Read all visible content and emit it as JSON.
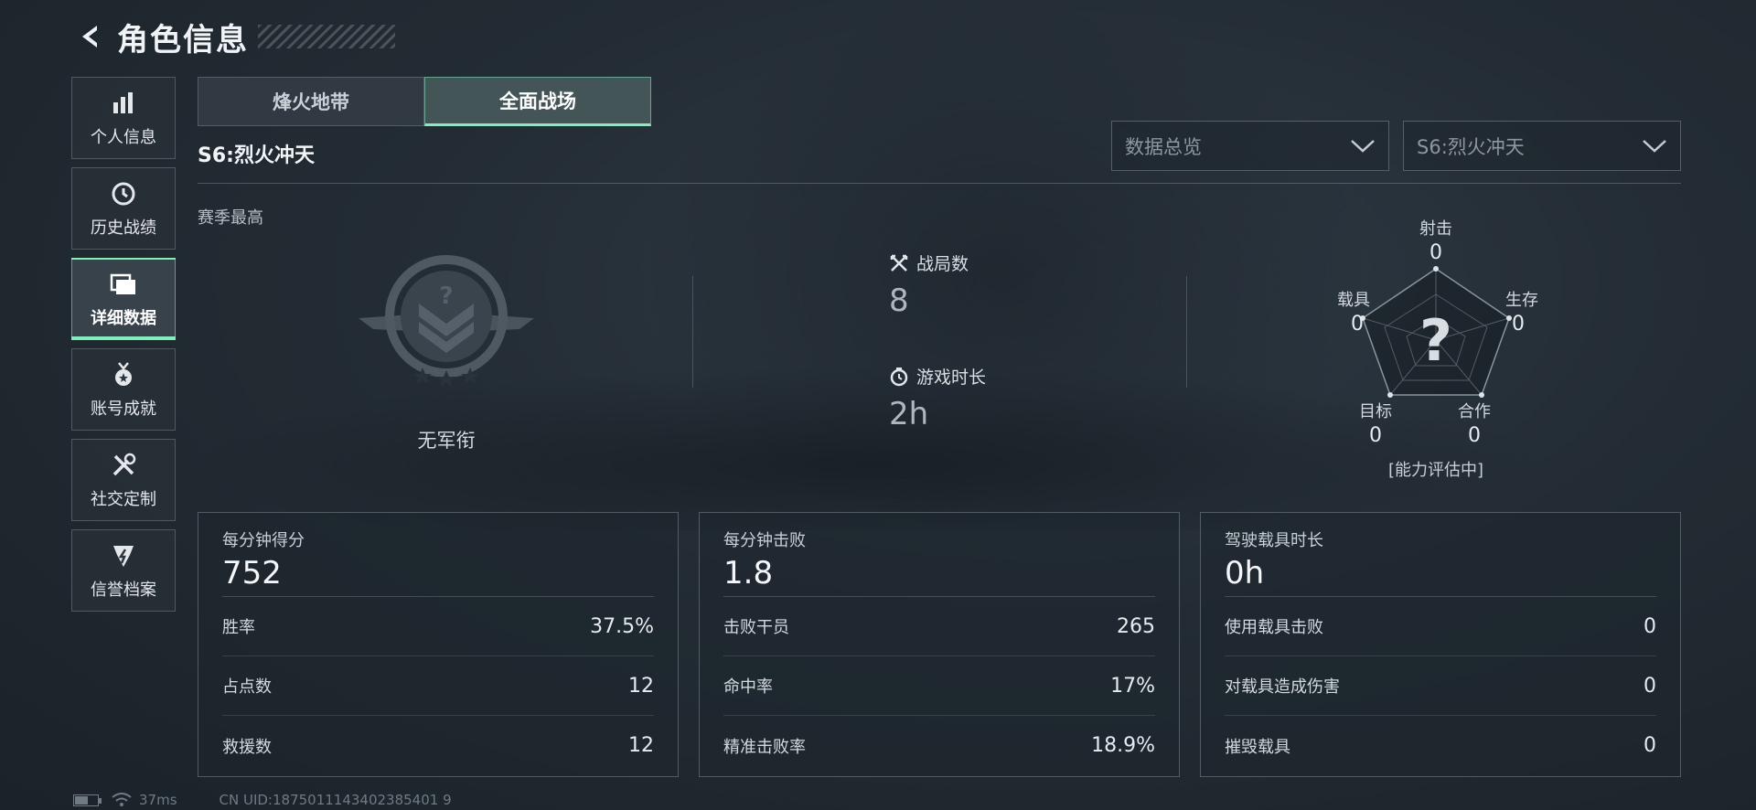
{
  "header": {
    "title": "角色信息"
  },
  "sidebar": {
    "items": [
      {
        "label": "个人信息",
        "icon": "bar-chart-icon"
      },
      {
        "label": "历史战绩",
        "icon": "history-clock-icon"
      },
      {
        "label": "详细数据",
        "icon": "folders-icon",
        "active": true
      },
      {
        "label": "账号成就",
        "icon": "medal-icon"
      },
      {
        "label": "社交定制",
        "icon": "tools-icon"
      },
      {
        "label": "信誉档案",
        "icon": "badge-icon"
      }
    ]
  },
  "tabs": [
    {
      "label": "烽火地带",
      "active": false
    },
    {
      "label": "全面战场",
      "active": true
    }
  ],
  "season": {
    "label": "S6:烈火冲天"
  },
  "dropdowns": {
    "view": "数据总览",
    "season": "S6:烈火冲天"
  },
  "season_best": "赛季最高",
  "rank": {
    "name": "无军衔"
  },
  "overview": {
    "matches_label": "战局数",
    "matches_value": "8",
    "playtime_label": "游戏时长",
    "playtime_value": "2h"
  },
  "radar": {
    "labels": {
      "shoot": "射击",
      "survive": "生存",
      "coop": "合作",
      "target": "目标",
      "vehicle": "载具"
    },
    "values": {
      "shoot": "0",
      "survive": "0",
      "coop": "0",
      "target": "0",
      "vehicle": "0"
    },
    "note": "[能力评估中]"
  },
  "cards": [
    {
      "head_label": "每分钟得分",
      "head_value": "752",
      "rows": [
        {
          "k": "胜率",
          "v": "37.5%"
        },
        {
          "k": "占点数",
          "v": "12"
        },
        {
          "k": "救援数",
          "v": "12"
        }
      ]
    },
    {
      "head_label": "每分钟击败",
      "head_value": "1.8",
      "rows": [
        {
          "k": "击败干员",
          "v": "265"
        },
        {
          "k": "命中率",
          "v": "17%"
        },
        {
          "k": "精准击败率",
          "v": "18.9%"
        }
      ]
    },
    {
      "head_label": "驾驶载具时长",
      "head_value": "0h",
      "rows": [
        {
          "k": "使用载具击败",
          "v": "0"
        },
        {
          "k": "对载具造成伤害",
          "v": "0"
        },
        {
          "k": "摧毁载具",
          "v": "0"
        }
      ]
    }
  ],
  "footer": {
    "ping": "37ms",
    "uid": "CN UID:1875011143402385401 9"
  },
  "colors": {
    "accent": "#7ef0b9",
    "background": "#232c34"
  }
}
